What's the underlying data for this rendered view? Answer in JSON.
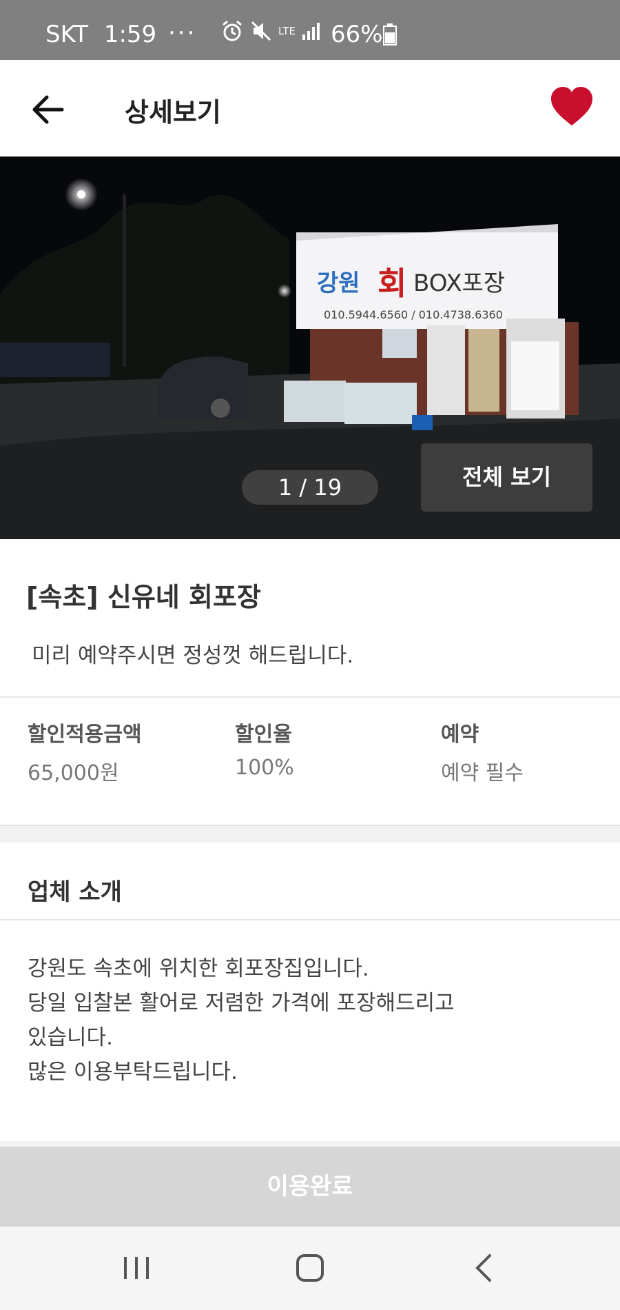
{
  "status_bar": {
    "carrier": "SKT",
    "time": "1:59",
    "dots": "···",
    "network": "LTE",
    "battery": "66%"
  },
  "header": {
    "title": "상세보기",
    "favorite_active": true,
    "accent_color": "#c8102e"
  },
  "gallery": {
    "counter": "1 / 19",
    "view_all_label": "전체 보기",
    "sign_text": "회 BOX포장",
    "sign_phone": "010.5944.6560 / 010.4738.6360"
  },
  "store": {
    "title": "[속초] 신유네 회포장",
    "tagline": "미리 예약주시면 정성껏 해드립니다."
  },
  "stats": [
    {
      "label": "할인적용금액",
      "value": "65,000원"
    },
    {
      "label": "할인율",
      "value": "100%"
    },
    {
      "label": "예약",
      "value": "예약 필수"
    }
  ],
  "intro": {
    "title": "업체 소개",
    "body": " 강원도 속초에 위치한 회포장집입니다.\n 당일 입찰본 활어로 저렴한 가격에 포장해드리고\n있습니다.\n 많은 이용부탁드립니다."
  },
  "action": {
    "label": "이용완료"
  }
}
